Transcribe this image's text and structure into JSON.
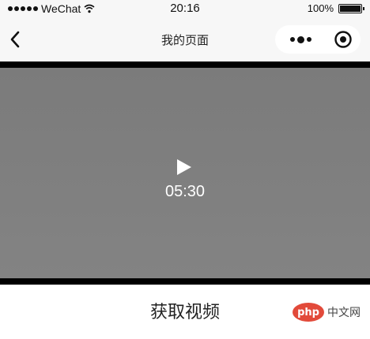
{
  "status_bar": {
    "carrier": "WeChat",
    "time": "20:16",
    "battery": "100%",
    "icons": [
      "signal-icon",
      "wifi-icon",
      "battery-icon"
    ]
  },
  "nav": {
    "title": "我的页面",
    "icons": [
      "back-icon",
      "more-icon",
      "close-icon"
    ]
  },
  "video": {
    "duration": "05:30",
    "icons": [
      "play-icon"
    ]
  },
  "actions": {
    "get_video_label": "获取视频"
  },
  "watermark": {
    "logo_text": "php",
    "site_text": "中文网"
  },
  "colors": {
    "bar_bg": "#f7f7f7",
    "video_bg": "#808080",
    "watermark_red": "#e24a3a"
  }
}
